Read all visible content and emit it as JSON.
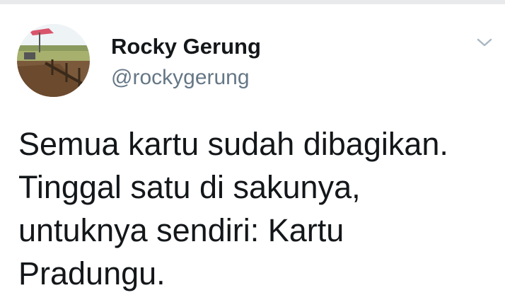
{
  "tweet": {
    "author": {
      "display_name": "Rocky Gerung",
      "handle": "@rockygerung",
      "avatar": "avatar-photo"
    },
    "menu_icon": "chevron-down-icon",
    "text": "Semua kartu sudah dibagikan.\nTinggal satu di sakunya,\nuntuknya sendiri: Kartu\nPradungu."
  }
}
